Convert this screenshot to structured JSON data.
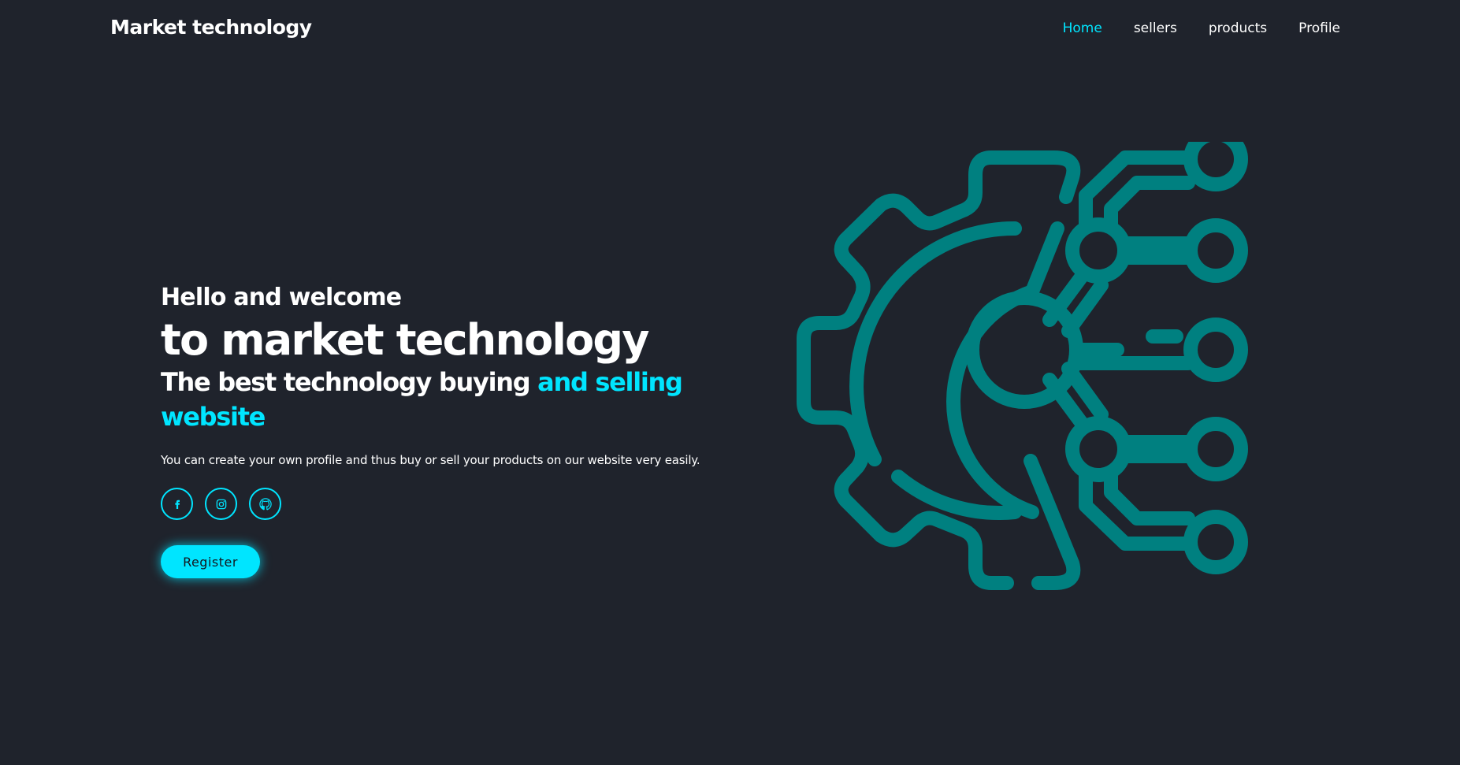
{
  "header": {
    "brand": "Market technology",
    "nav": [
      {
        "label": "Home",
        "active": true
      },
      {
        "label": "sellers",
        "active": false
      },
      {
        "label": "products",
        "active": false
      },
      {
        "label": "Profile",
        "active": false
      }
    ]
  },
  "hero": {
    "welcome": "Hello and welcome",
    "headline": "to market technology",
    "tagline_main": "The best technology buying ",
    "tagline_accent": "and selling website",
    "description": "You can create your own profile and thus buy or sell your products on our website very easily.",
    "socials": [
      {
        "icon": "facebook-icon"
      },
      {
        "icon": "instagram-icon"
      },
      {
        "icon": "github-icon"
      }
    ],
    "register_label": "Register",
    "illustration_icon": "gear-circuit-icon"
  },
  "colors": {
    "background": "#1f232c",
    "accent": "#00e5ff",
    "illustration": "#008080",
    "text": "#ffffff"
  }
}
